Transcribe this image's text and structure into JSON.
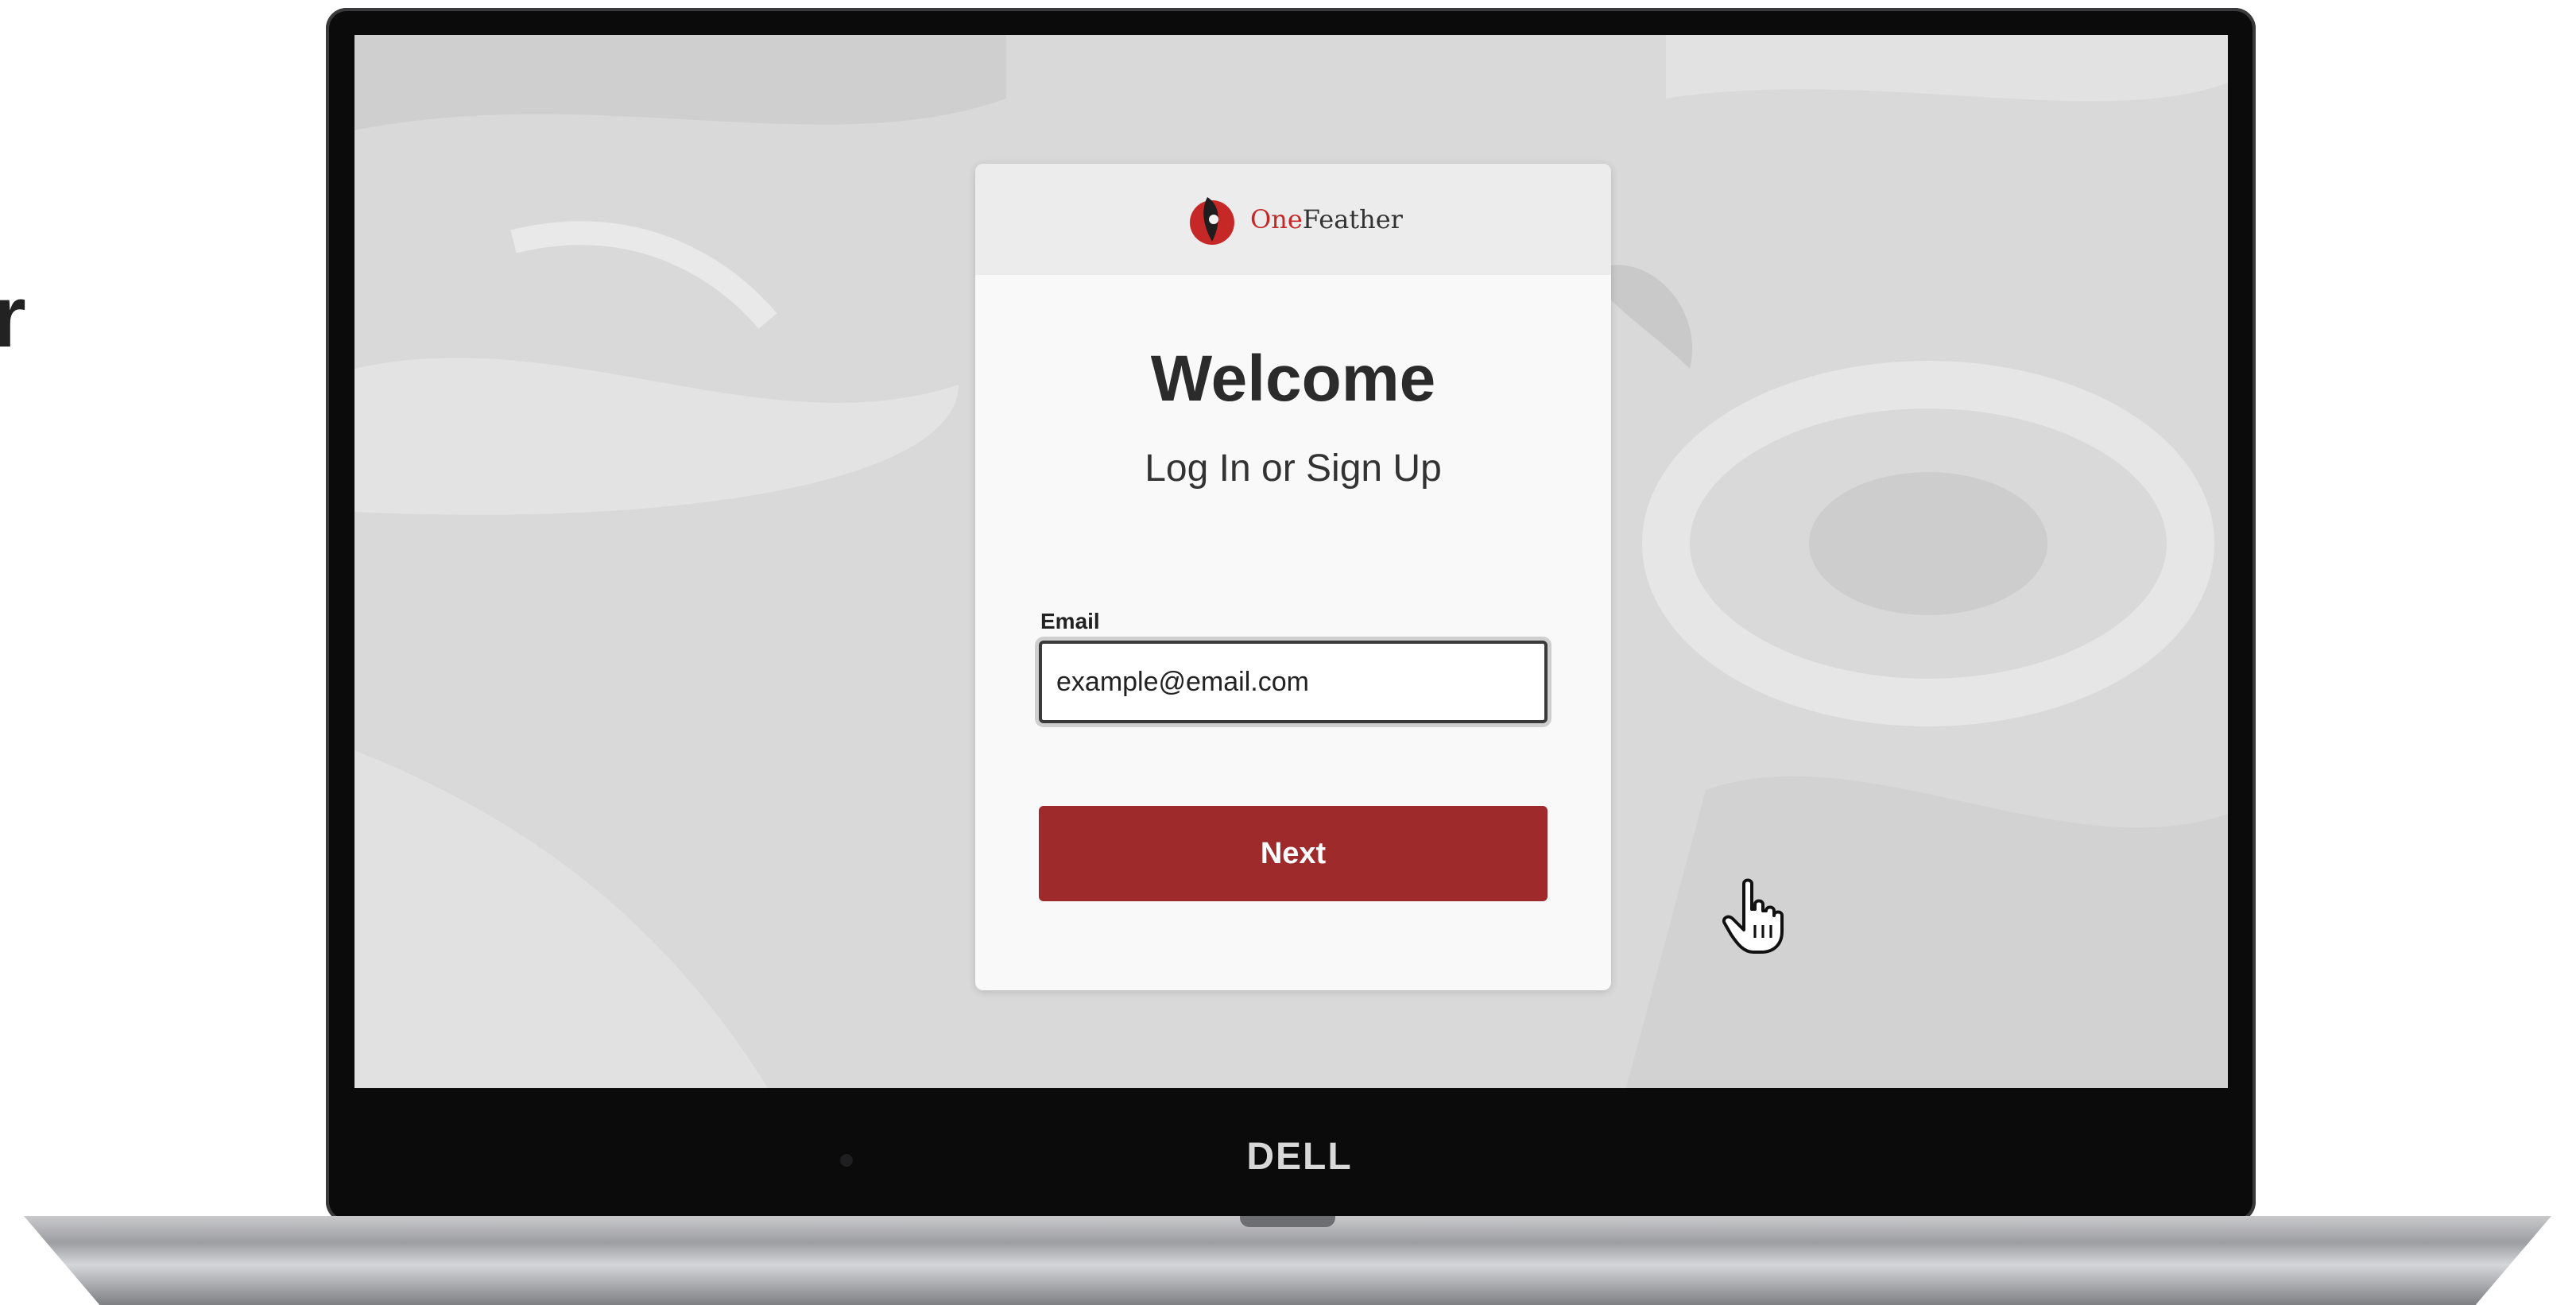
{
  "edge_text": "r",
  "laptop": {
    "brand": "DELL"
  },
  "login": {
    "logo": {
      "prefix": "One",
      "suffix": "Feather",
      "icon": "feather-logo-icon"
    },
    "title": "Welcome",
    "subtitle": "Log In or Sign Up",
    "email": {
      "label": "Email",
      "value": "example@email.com",
      "placeholder": ""
    },
    "next_label": "Next"
  },
  "colors": {
    "primary": "#9e2a2b",
    "logo_accent": "#c62828",
    "card_bg": "#f9f9f9",
    "screen_bg": "#d9d9d9"
  },
  "cursor": "hand-pointer-icon"
}
